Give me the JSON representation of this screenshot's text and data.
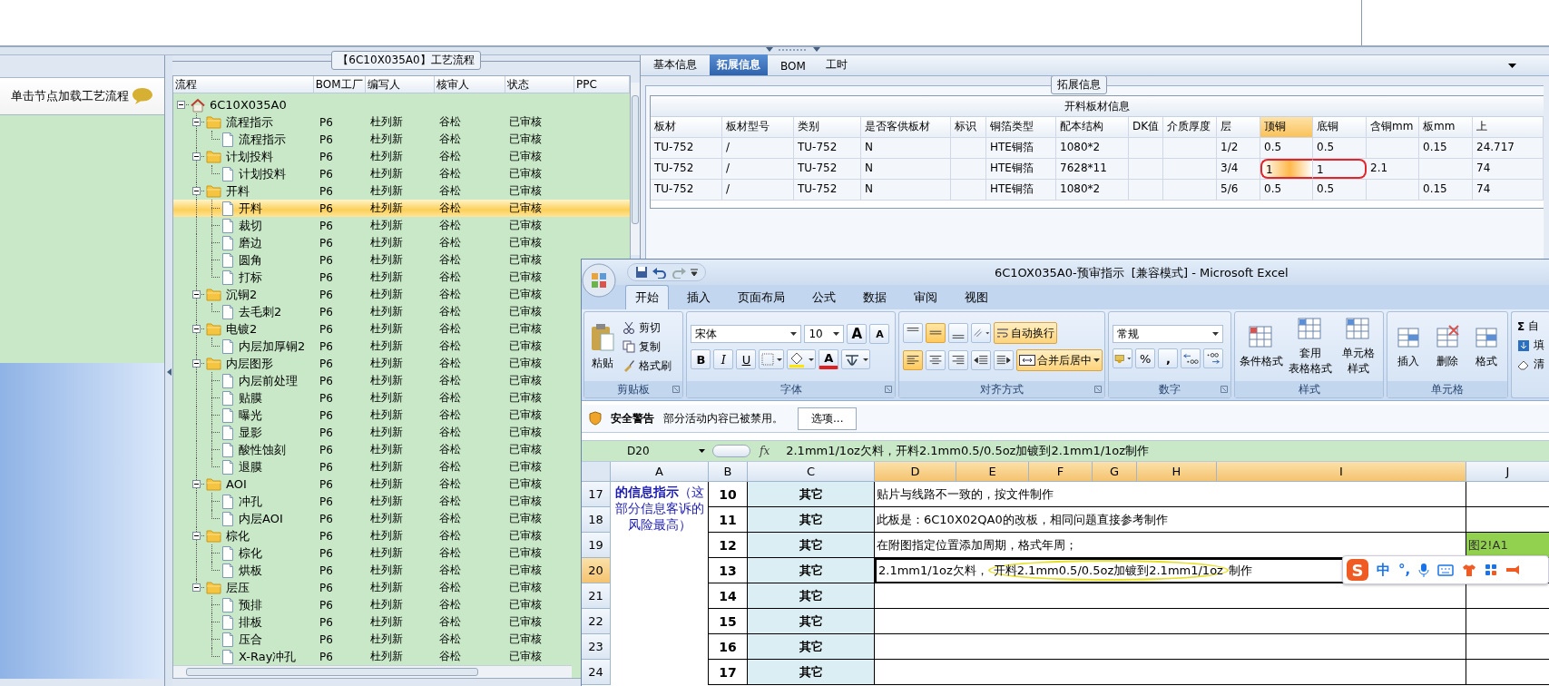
{
  "splitter": {
    "kind": "grip"
  },
  "left_panel": {
    "header": "单击节点加载工艺流程"
  },
  "process_group": {
    "title": "【6C10X035A0】工艺流程"
  },
  "grid_columns": [
    "流程",
    "BOM工厂",
    "编写人",
    "核审人",
    "状态",
    "PPC"
  ],
  "tree": {
    "label": "6C10X035A0",
    "kind": "root",
    "expanded": true,
    "selected": false,
    "children": [
      {
        "label": "流程指示",
        "kind": "folder",
        "expanded": true,
        "selected": false,
        "bom": "P6",
        "writer": "杜列新",
        "reviewer": "谷松",
        "status": "已审核",
        "children": [
          {
            "label": "流程指示",
            "kind": "doc",
            "selected": false,
            "bom": "P6",
            "writer": "杜列新",
            "reviewer": "谷松",
            "status": "已审核"
          }
        ]
      },
      {
        "label": "计划投料",
        "kind": "folder",
        "expanded": true,
        "selected": false,
        "bom": "P6",
        "writer": "杜列新",
        "reviewer": "谷松",
        "status": "已审核",
        "children": [
          {
            "label": "计划投料",
            "kind": "doc",
            "selected": false,
            "bom": "P6",
            "writer": "杜列新",
            "reviewer": "谷松",
            "status": "已审核"
          }
        ]
      },
      {
        "label": "开料",
        "kind": "folder",
        "expanded": true,
        "selected": false,
        "bom": "P6",
        "writer": "杜列新",
        "reviewer": "谷松",
        "status": "已审核",
        "children": [
          {
            "label": "开料",
            "kind": "doc",
            "selected": true,
            "bom": "P6",
            "writer": "杜列新",
            "reviewer": "谷松",
            "status": "已审核"
          },
          {
            "label": "裁切",
            "kind": "doc",
            "selected": false,
            "bom": "P6",
            "writer": "杜列新",
            "reviewer": "谷松",
            "status": "已审核"
          },
          {
            "label": "磨边",
            "kind": "doc",
            "selected": false,
            "bom": "P6",
            "writer": "杜列新",
            "reviewer": "谷松",
            "status": "已审核"
          },
          {
            "label": "圆角",
            "kind": "doc",
            "selected": false,
            "bom": "P6",
            "writer": "杜列新",
            "reviewer": "谷松",
            "status": "已审核"
          },
          {
            "label": "打标",
            "kind": "doc",
            "selected": false,
            "bom": "P6",
            "writer": "杜列新",
            "reviewer": "谷松",
            "status": "已审核"
          }
        ]
      },
      {
        "label": "沉铜2",
        "kind": "folder",
        "expanded": true,
        "selected": false,
        "bom": "P6",
        "writer": "杜列新",
        "reviewer": "谷松",
        "status": "已审核",
        "children": [
          {
            "label": "去毛刺2",
            "kind": "doc",
            "selected": false,
            "bom": "P6",
            "writer": "杜列新",
            "reviewer": "谷松",
            "status": "已审核"
          }
        ]
      },
      {
        "label": "电镀2",
        "kind": "folder",
        "expanded": true,
        "selected": false,
        "bom": "P6",
        "writer": "杜列新",
        "reviewer": "谷松",
        "status": "已审核",
        "children": [
          {
            "label": "内层加厚铜2",
            "kind": "doc",
            "selected": false,
            "bom": "P6",
            "writer": "杜列新",
            "reviewer": "谷松",
            "status": "已审核"
          }
        ]
      },
      {
        "label": "内层图形",
        "kind": "folder",
        "expanded": true,
        "selected": false,
        "bom": "P6",
        "writer": "杜列新",
        "reviewer": "谷松",
        "status": "已审核",
        "children": [
          {
            "label": "内层前处理",
            "kind": "doc",
            "selected": false,
            "bom": "P6",
            "writer": "杜列新",
            "reviewer": "谷松",
            "status": "已审核"
          },
          {
            "label": "贴膜",
            "kind": "doc",
            "selected": false,
            "bom": "P6",
            "writer": "杜列新",
            "reviewer": "谷松",
            "status": "已审核"
          },
          {
            "label": "曝光",
            "kind": "doc",
            "selected": false,
            "bom": "P6",
            "writer": "杜列新",
            "reviewer": "谷松",
            "status": "已审核"
          },
          {
            "label": "显影",
            "kind": "doc",
            "selected": false,
            "bom": "P6",
            "writer": "杜列新",
            "reviewer": "谷松",
            "status": "已审核"
          },
          {
            "label": "酸性蚀刻",
            "kind": "doc",
            "selected": false,
            "bom": "P6",
            "writer": "杜列新",
            "reviewer": "谷松",
            "status": "已审核"
          },
          {
            "label": "退膜",
            "kind": "doc",
            "selected": false,
            "bom": "P6",
            "writer": "杜列新",
            "reviewer": "谷松",
            "status": "已审核"
          }
        ]
      },
      {
        "label": "AOI",
        "kind": "folder",
        "expanded": true,
        "selected": false,
        "bom": "P6",
        "writer": "杜列新",
        "reviewer": "谷松",
        "status": "已审核",
        "children": [
          {
            "label": "冲孔",
            "kind": "doc",
            "selected": false,
            "bom": "P6",
            "writer": "杜列新",
            "reviewer": "谷松",
            "status": "已审核"
          },
          {
            "label": "内层AOI",
            "kind": "doc",
            "selected": false,
            "bom": "P6",
            "writer": "杜列新",
            "reviewer": "谷松",
            "status": "已审核"
          }
        ]
      },
      {
        "label": "棕化",
        "kind": "folder",
        "expanded": true,
        "selected": false,
        "bom": "P6",
        "writer": "杜列新",
        "reviewer": "谷松",
        "status": "已审核",
        "children": [
          {
            "label": "棕化",
            "kind": "doc",
            "selected": false,
            "bom": "P6",
            "writer": "杜列新",
            "reviewer": "谷松",
            "status": "已审核"
          },
          {
            "label": "烘板",
            "kind": "doc",
            "selected": false,
            "bom": "P6",
            "writer": "杜列新",
            "reviewer": "谷松",
            "status": "已审核"
          }
        ]
      },
      {
        "label": "层压",
        "kind": "folder",
        "expanded": true,
        "selected": false,
        "bom": "P6",
        "writer": "杜列新",
        "reviewer": "谷松",
        "status": "已审核",
        "children": [
          {
            "label": "预排",
            "kind": "doc",
            "selected": false,
            "bom": "P6",
            "writer": "杜列新",
            "reviewer": "谷松",
            "status": "已审核"
          },
          {
            "label": "排板",
            "kind": "doc",
            "selected": false,
            "bom": "P6",
            "writer": "杜列新",
            "reviewer": "谷松",
            "status": "已审核"
          },
          {
            "label": "压合",
            "kind": "doc",
            "selected": false,
            "bom": "P6",
            "writer": "杜列新",
            "reviewer": "谷松",
            "status": "已审核"
          },
          {
            "label": "X-Ray冲孔",
            "kind": "doc",
            "selected": false,
            "bom": "P6",
            "writer": "杜列新",
            "reviewer": "谷松",
            "status": "已审核"
          }
        ]
      }
    ]
  },
  "tabs": [
    {
      "label": "基本信息",
      "selected": false
    },
    {
      "label": "拓展信息",
      "selected": true
    },
    {
      "label": "BOM",
      "selected": false
    },
    {
      "label": "工时",
      "selected": false
    }
  ],
  "ext_group": {
    "title": "拓展信息"
  },
  "material_table": {
    "title": "开料板材信息",
    "columns": [
      {
        "label": "板材",
        "selected": false,
        "circle": false
      },
      {
        "label": "板材型号",
        "selected": false,
        "circle": false
      },
      {
        "label": "类别",
        "selected": false,
        "circle": false
      },
      {
        "label": "是否客供板材",
        "selected": false,
        "circle": false
      },
      {
        "label": "标识",
        "selected": false,
        "circle": false
      },
      {
        "label": "铜箔类型",
        "selected": false,
        "circle": false
      },
      {
        "label": "配本结构",
        "selected": false,
        "circle": false
      },
      {
        "label": "DK值",
        "selected": false,
        "circle": false
      },
      {
        "label": "介质厚度",
        "selected": false,
        "circle": false
      },
      {
        "label": "层",
        "selected": false,
        "circle": false
      },
      {
        "label": "顶铜",
        "selected": true,
        "circle": true
      },
      {
        "label": "底铜",
        "selected": false,
        "circle": true
      },
      {
        "label": "含铜mm",
        "selected": false,
        "circle": false
      },
      {
        "label": "板mm",
        "selected": false,
        "circle": false
      },
      {
        "label": "上",
        "selected": false,
        "circle": false
      }
    ],
    "rows": [
      {
        "selected": false,
        "circled": false,
        "cells": [
          "TU-752",
          "/",
          "TU-752",
          "N",
          "",
          "HTE铜箔",
          "1080*2",
          "",
          "",
          "1/2",
          "0.5",
          "0.5",
          "",
          "0.15",
          "24.717"
        ]
      },
      {
        "selected": true,
        "circled": true,
        "cells": [
          "TU-752",
          "/",
          "TU-752",
          "N",
          "",
          "HTE铜箔",
          "7628*11",
          "",
          "",
          "3/4",
          "1",
          "1",
          "2.1",
          "",
          "74"
        ]
      },
      {
        "selected": false,
        "circled": false,
        "cells": [
          "TU-752",
          "/",
          "TU-752",
          "N",
          "",
          "HTE铜箔",
          "1080*2",
          "",
          "",
          "5/6",
          "0.5",
          "0.5",
          "",
          "0.15",
          "74"
        ]
      }
    ]
  },
  "excel": {
    "title": "6C1OX035A0-预审指示  [兼容模式] - Microsoft Excel",
    "ribbon_tabs": [
      {
        "label": "开始",
        "selected": true
      },
      {
        "label": "插入",
        "selected": false
      },
      {
        "label": "页面布局",
        "selected": false
      },
      {
        "label": "公式",
        "selected": false
      },
      {
        "label": "数据",
        "selected": false
      },
      {
        "label": "审阅",
        "selected": false
      },
      {
        "label": "视图",
        "selected": false
      }
    ],
    "clipboard": {
      "label": "剪贴板",
      "paste": "粘贴",
      "cut": "剪切",
      "copy": "复制",
      "format_painter": "格式刷"
    },
    "font": {
      "label": "字体",
      "name": "宋体",
      "size": "10",
      "grow": "A",
      "shrink": "A",
      "bold": "B",
      "italic": "I",
      "underline": "U",
      "font_color_letter": "A"
    },
    "alignment": {
      "label": "对齐方式",
      "vertical": [
        {
          "selected": false
        },
        {
          "selected": true
        },
        {
          "selected": false
        }
      ],
      "horizontal": [
        {
          "selected": true
        },
        {
          "selected": false
        },
        {
          "selected": false
        }
      ],
      "wrap": {
        "label": "自动换行",
        "on": true
      },
      "merge": {
        "label": "合并后居中",
        "on": true
      }
    },
    "number": {
      "label": "数字",
      "format": "常规",
      "percent": "%",
      "comma": ","
    },
    "styles": {
      "label": "样式",
      "buttons": [
        {
          "lines": [
            "条件格式"
          ]
        },
        {
          "lines": [
            "套用",
            "表格格式"
          ]
        },
        {
          "lines": [
            "单元格",
            "样式"
          ]
        }
      ]
    },
    "cells": {
      "label": "单元格",
      "buttons": [
        "插入",
        "删除",
        "格式"
      ]
    },
    "editing": {
      "sigma": "Σ",
      "autosum": "自",
      "fill": "填",
      "clear": "清"
    },
    "security": {
      "title": "安全警告",
      "message": "部分活动内容已被禁用。",
      "button": "选项..."
    },
    "formula_bar": {
      "name_box": "D20",
      "fx": "fx",
      "formula": "2.1mm1/1oz欠料，开料2.1mm0.5/0.5oz加镀到2.1mm1/1oz制作"
    },
    "columns": [
      {
        "label": "A",
        "selected": false
      },
      {
        "label": "B",
        "selected": false
      },
      {
        "label": "C",
        "selected": false
      },
      {
        "label": "D",
        "selected": true
      },
      {
        "label": "E",
        "selected": true
      },
      {
        "label": "F",
        "selected": true
      },
      {
        "label": "G",
        "selected": true
      },
      {
        "label": "H",
        "selected": true
      },
      {
        "label": "I",
        "selected": true
      },
      {
        "label": "J",
        "selected": false
      }
    ],
    "a_text": "**的信息指示**（这部分信息客诉的风险最高）",
    "rows": [
      {
        "number": "17",
        "selected": false,
        "b": "10",
        "c": "其它",
        "d": [
          {
            "text": "贴片与线路不一致的，按文件制作",
            "circled": false
          }
        ]
      },
      {
        "number": "18",
        "selected": false,
        "b": "11",
        "c": "其它",
        "d": [
          {
            "text": "此板是：6C10X02QA0的改板，相同问题直接参考制作",
            "circled": false
          }
        ]
      },
      {
        "number": "19",
        "selected": false,
        "b": "12",
        "c": "其它",
        "d": [
          {
            "text": "在附图指定位置添加周期，格式年周；",
            "circled": false
          }
        ],
        "j": "图2!A1"
      },
      {
        "number": "20",
        "selected": true,
        "b": "13",
        "c": "其它",
        "d": [
          {
            "text": "2.1mm1/1oz欠料，",
            "circled": false
          },
          {
            "text": "开料2.1mm0.5/0.5oz加镀到2.1mm1/1oz",
            "circled": true
          },
          {
            "text": "制作",
            "circled": false
          }
        ]
      },
      {
        "number": "21",
        "selected": false,
        "b": "14",
        "c": "其它",
        "d": []
      },
      {
        "number": "22",
        "selected": false,
        "b": "15",
        "c": "其它",
        "d": []
      },
      {
        "number": "23",
        "selected": false,
        "b": "16",
        "c": "其它",
        "d": []
      },
      {
        "number": "24",
        "selected": false,
        "b": "17",
        "c": "其它",
        "d": []
      }
    ],
    "ime": {
      "logo": "S",
      "mode": "中",
      "punct": "°,"
    }
  }
}
